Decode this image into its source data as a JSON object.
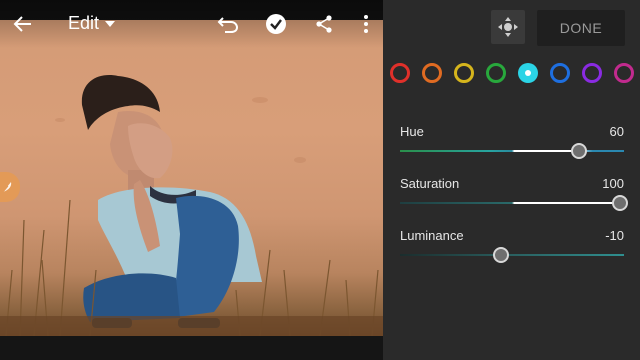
{
  "app_bar": {
    "edit_label": "Edit",
    "icons": [
      "back-arrow-icon",
      "undo-icon",
      "check-icon",
      "share-icon",
      "more-vertical-icon"
    ]
  },
  "panel": {
    "done_label": "DONE",
    "target_icon": "targeted-adjustment-icon",
    "swatches": [
      {
        "name": "red",
        "color": "#e0302a",
        "selected": false
      },
      {
        "name": "orange",
        "color": "#e06b22",
        "selected": false
      },
      {
        "name": "yellow",
        "color": "#d6b51c",
        "selected": false
      },
      {
        "name": "green",
        "color": "#28a83c",
        "selected": false
      },
      {
        "name": "aqua",
        "color": "#2bd4e6",
        "selected": true
      },
      {
        "name": "blue",
        "color": "#1e6fe0",
        "selected": false
      },
      {
        "name": "purple",
        "color": "#8a2be2",
        "selected": false
      },
      {
        "name": "magenta",
        "color": "#c22a8e",
        "selected": false
      }
    ],
    "sliders": {
      "hue": {
        "label": "Hue",
        "value": "60",
        "min": -100,
        "max": 100,
        "position": 60
      },
      "saturation": {
        "label": "Saturation",
        "value": "100",
        "min": -100,
        "max": 100,
        "position": 100
      },
      "luminance": {
        "label": "Luminance",
        "value": "-10",
        "min": -100,
        "max": 100,
        "position": -10
      }
    }
  },
  "colors": {
    "panel_bg": "#2a2a2a",
    "photo_orange": "#d49b76",
    "side_tab": "#e39a57"
  }
}
